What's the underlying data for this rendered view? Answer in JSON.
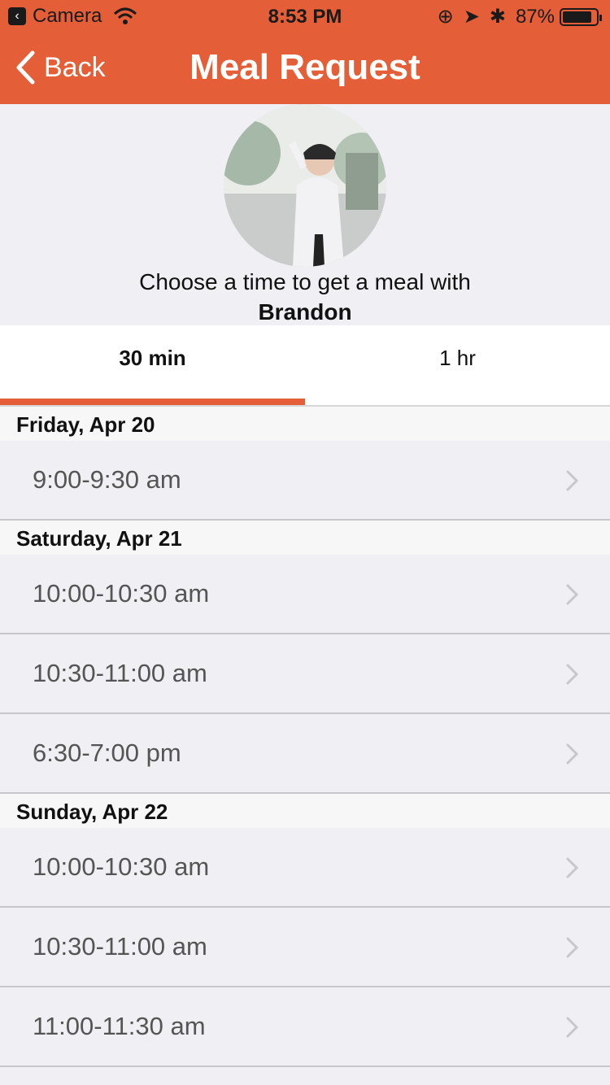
{
  "status_bar": {
    "back_app": "Camera",
    "time": "8:53 PM",
    "battery": "87%",
    "battery_level": 0.87
  },
  "nav": {
    "back_label": "Back",
    "title": "Meal Request"
  },
  "profile": {
    "prompt": "Choose a time to get a meal with",
    "name": "Brandon"
  },
  "tabs": [
    {
      "label": "30 min",
      "active": true
    },
    {
      "label": "1 hr",
      "active": false
    }
  ],
  "sections": [
    {
      "day": "Friday, Apr 20",
      "slots": [
        "9:00-9:30 am"
      ]
    },
    {
      "day": "Saturday, Apr 21",
      "slots": [
        "10:00-10:30 am",
        "10:30-11:00 am",
        "6:30-7:00 pm"
      ]
    },
    {
      "day": "Sunday, Apr 22",
      "slots": [
        "10:00-10:30 am",
        "10:30-11:00 am",
        "11:00-11:30 am"
      ]
    }
  ],
  "colors": {
    "accent": "#e45f37",
    "background": "#efeff4"
  }
}
